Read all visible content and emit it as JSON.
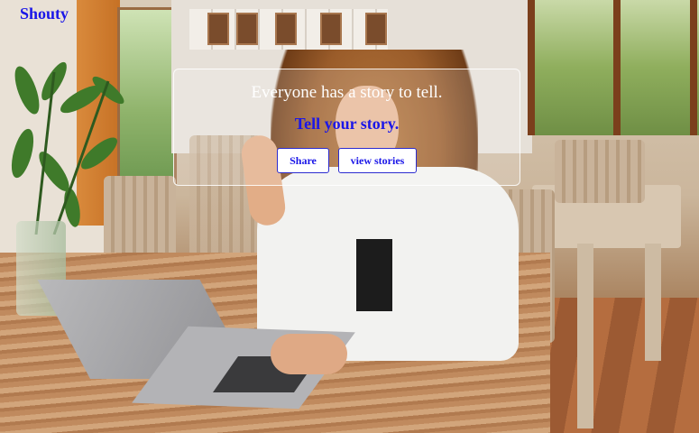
{
  "brand": {
    "name": "Shouty"
  },
  "hero": {
    "heading": "Everyone has a story to tell.",
    "subheading": "Tell your story.",
    "buttons": {
      "share_label": "Share",
      "view_label": "view stories"
    }
  },
  "colors": {
    "accent": "#1a16e8",
    "hero_text": "#ffffff",
    "button_bg": "#ffffff"
  }
}
